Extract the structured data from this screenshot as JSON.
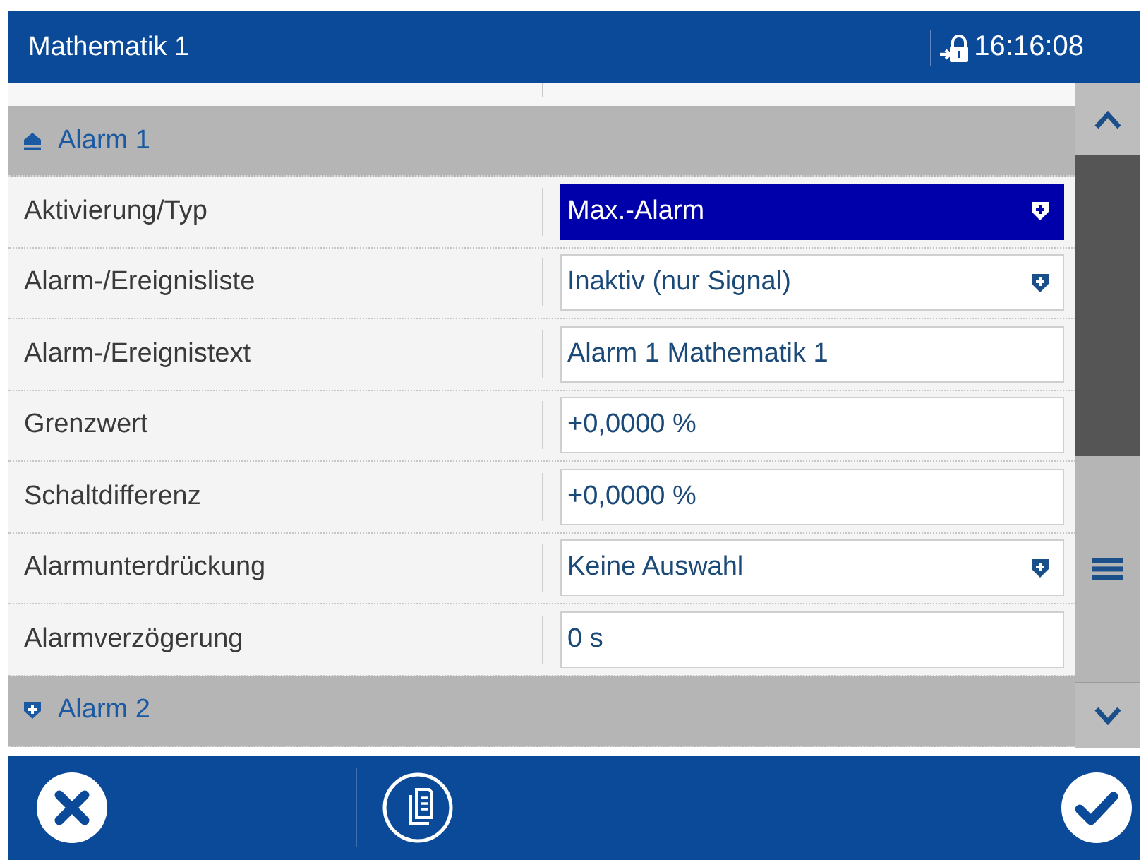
{
  "header": {
    "title": "Mathematik 1",
    "time": "16:16:08"
  },
  "sections": [
    {
      "title": "Alarm 1",
      "expanded": true,
      "rows": [
        {
          "label": "Aktivierung/Typ",
          "kind": "dropdown",
          "value": "Max.-Alarm",
          "selected": true
        },
        {
          "label": "Alarm-/Ereignisliste",
          "kind": "dropdown",
          "value": "Inaktiv (nur Signal)",
          "selected": false
        },
        {
          "label": "Alarm-/Ereignistext",
          "kind": "text",
          "value": "Alarm 1 Mathematik 1",
          "selected": false
        },
        {
          "label": "Grenzwert",
          "kind": "text",
          "value": "+0,0000 %",
          "selected": false
        },
        {
          "label": "Schaltdifferenz",
          "kind": "text",
          "value": "+0,0000 %",
          "selected": false
        },
        {
          "label": "Alarmunterdrückung",
          "kind": "dropdown",
          "value": "Keine Auswahl",
          "selected": false
        },
        {
          "label": "Alarmverzögerung",
          "kind": "text",
          "value": "0 s",
          "selected": false
        }
      ]
    },
    {
      "title": "Alarm 2",
      "expanded": false
    }
  ]
}
